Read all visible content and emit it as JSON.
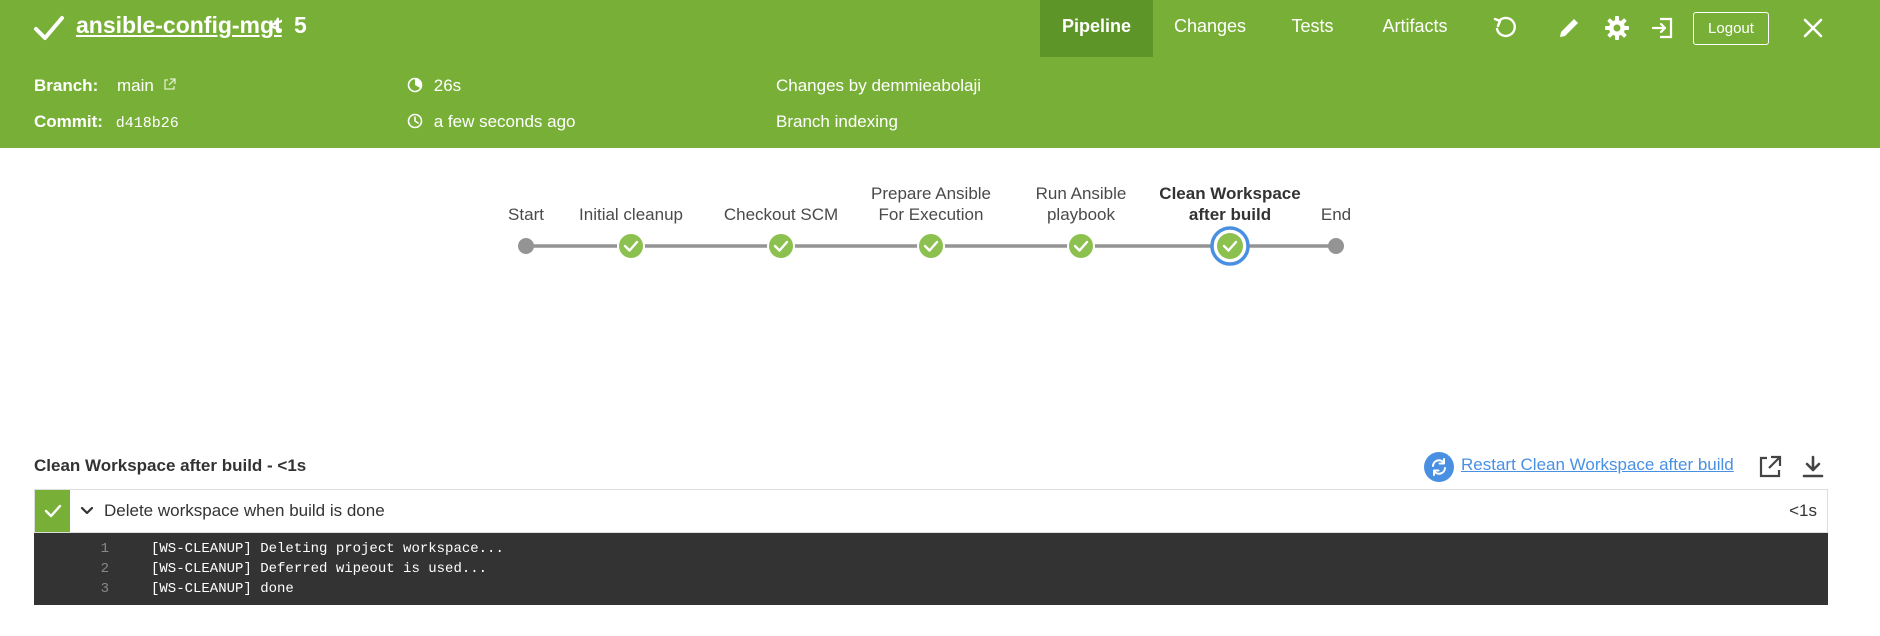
{
  "header": {
    "pipeline_name": "ansible-config-mgt",
    "separator": "<",
    "run_number": "5",
    "tabs": [
      {
        "label": "Pipeline",
        "active": true
      },
      {
        "label": "Changes",
        "active": false
      },
      {
        "label": "Tests",
        "active": false
      },
      {
        "label": "Artifacts",
        "active": false
      }
    ],
    "logout_label": "Logout",
    "brand_color": "#78b037",
    "active_tab_color": "#5e9528"
  },
  "info": {
    "branch_label": "Branch:",
    "branch_value": "main",
    "commit_label": "Commit:",
    "commit_value": "d418b26",
    "duration": "26s",
    "started": "a few seconds ago",
    "changes": "Changes by demmieabolaji",
    "cause": "Branch indexing"
  },
  "pipeline": {
    "stages": [
      {
        "label_lines": [
          "Start"
        ],
        "status": "start"
      },
      {
        "label_lines": [
          "Initial cleanup"
        ],
        "status": "success"
      },
      {
        "label_lines": [
          "Checkout SCM"
        ],
        "status": "success"
      },
      {
        "label_lines": [
          "Prepare Ansible",
          "For Execution"
        ],
        "status": "success"
      },
      {
        "label_lines": [
          "Run Ansible",
          "playbook"
        ],
        "status": "success"
      },
      {
        "label_lines": [
          "Clean Workspace",
          "after build"
        ],
        "status": "success",
        "selected": true
      },
      {
        "label_lines": [
          "End"
        ],
        "status": "end"
      }
    ]
  },
  "step_panel": {
    "title": "Clean Workspace after build - <1s",
    "restart_label": "Restart Clean Workspace after build",
    "step_name": "Delete workspace when build is done",
    "step_duration": "<1s",
    "log_lines": [
      {
        "num": "1",
        "text": "[WS-CLEANUP] Deleting project workspace..."
      },
      {
        "num": "2",
        "text": "[WS-CLEANUP] Deferred wipeout is used..."
      },
      {
        "num": "3",
        "text": "[WS-CLEANUP] done"
      }
    ]
  },
  "icons": {
    "status": "check-icon",
    "replay": "replay-icon",
    "edit": "pencil-icon",
    "settings": "gear-icon",
    "exit": "exit-icon",
    "close": "close-icon",
    "branch_link": "external-link-icon",
    "duration": "timer-icon",
    "started": "clock-icon",
    "restart": "restart-icon",
    "open_log": "open-external-icon",
    "download": "download-icon"
  }
}
